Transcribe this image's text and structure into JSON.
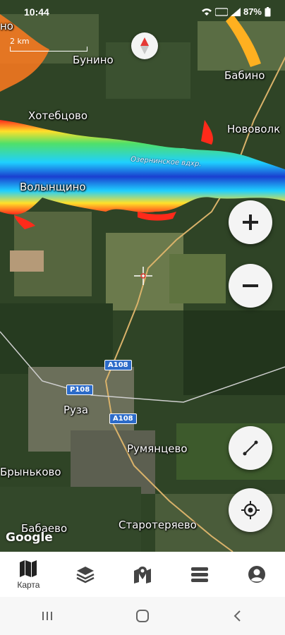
{
  "status": {
    "time": "10:44",
    "battery": "87%"
  },
  "map": {
    "scale_label": "2 km",
    "water_label": "Озернинское вдхр.",
    "google_label": "Google",
    "places": {
      "bunino": "Бунино",
      "babino": "Бабино",
      "khotebtsovo": "Хотебцово",
      "novovolk": "Нововолк",
      "volynshchino": "Волынщино",
      "ruza": "Руза",
      "rumyantsevo": "Румянцево",
      "brynkovo": "Брыньково",
      "babaevo": "Бабаево",
      "staroteryaevo": "Старотеряево",
      "no": "но"
    },
    "roads": {
      "a108_top": "A108",
      "r108": "P108",
      "a108_bottom": "A108"
    }
  },
  "nav": {
    "map_label": "Карта"
  },
  "icons": {
    "zoom_in": "plus-icon",
    "zoom_out": "minus-icon",
    "measure": "ruler-icon",
    "locate": "crosshair-icon",
    "compass": "compass-icon",
    "map": "map-icon",
    "layers": "layers-icon",
    "markers": "map-pin-icon",
    "menu": "menu-icon",
    "account": "account-icon"
  },
  "colors": {
    "water_deep": "#1a3fd0",
    "water_mid": "#1fd0ff",
    "water_shallow": "#4fe06a",
    "shore": "#ff2a1a"
  }
}
